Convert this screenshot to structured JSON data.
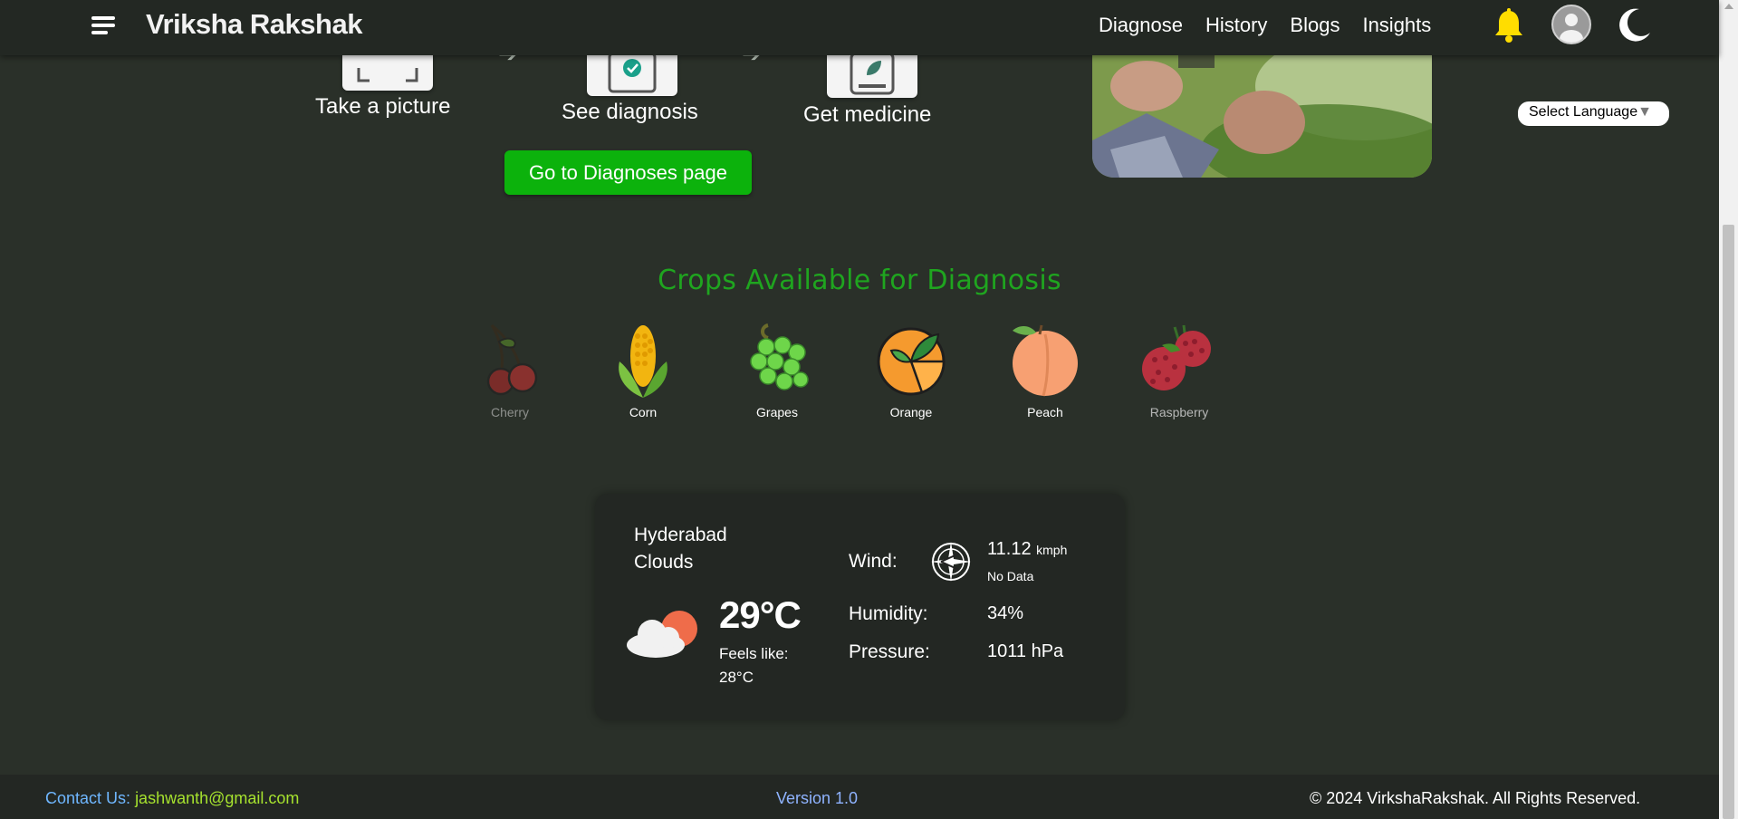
{
  "navbar": {
    "brand": "Vriksha Rakshak",
    "links": [
      "Diagnose",
      "History",
      "Blogs",
      "Insights"
    ],
    "icons": {
      "menu": "hamburger-icon",
      "notifications": "bell-icon",
      "profile": "avatar-icon",
      "theme": "moon-icon"
    },
    "bell_color": "#ffdd00"
  },
  "steps": [
    {
      "label": "Take a picture",
      "icon": "camera-frame-icon"
    },
    {
      "label": "See diagnosis",
      "icon": "check-clipboard-icon"
    },
    {
      "label": "Get medicine",
      "icon": "leaf-book-icon"
    }
  ],
  "diagnoses_button": "Go to Diagnoses page",
  "language_select": {
    "label": "Select Language",
    "caret": "▼"
  },
  "crops": {
    "title": "Crops Available for Diagnosis",
    "items": [
      "Cherry",
      "Corn",
      "Grapes",
      "Orange",
      "Peach",
      "Raspberry"
    ]
  },
  "weather": {
    "city": "Hyderabad",
    "condition": "Clouds",
    "temperature": "29°C",
    "feels_like_label": "Feels like:",
    "feels_like": "28°C",
    "wind_label": "Wind:",
    "wind_speed": "11.12",
    "wind_unit": "kmph",
    "wind_direction": "No Data",
    "humidity_label": "Humidity:",
    "humidity": "34%",
    "pressure_label": "Pressure:",
    "pressure": "1011 hPa"
  },
  "footer": {
    "contact_label": "Contact Us:",
    "contact_email": "jashwanth@gmail.com",
    "version": "Version 1.0",
    "copyright": "© 2024 VirkshaRakshak. All Rights Reserved."
  },
  "colors": {
    "accent": "#0cb20c",
    "title_green": "#1fa51f",
    "background": "#2a3029",
    "email": "#a6e22e",
    "contact": "#6fb7ff"
  }
}
